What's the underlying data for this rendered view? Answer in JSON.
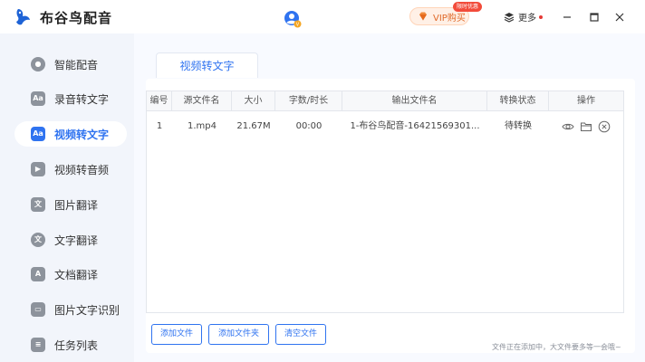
{
  "app": {
    "title": "布谷鸟配音"
  },
  "header": {
    "vip_label": "VIP购买",
    "vip_badge": "限时优惠",
    "more_label": "更多",
    "icons": [
      "bird-logo-icon",
      "user-avatar-icon",
      "diamond-icon",
      "layers-icon",
      "minimize-icon",
      "maximize-icon",
      "close-icon"
    ],
    "accent_color": "#2f73f0",
    "vip_color": "#e06a2a"
  },
  "sidebar": {
    "items": [
      {
        "label": "智能配音",
        "icon": "smart-dubbing-icon",
        "active": false
      },
      {
        "label": "录音转文字",
        "icon": "audio-to-text-icon",
        "active": false
      },
      {
        "label": "视频转文字",
        "icon": "video-to-text-icon",
        "active": true
      },
      {
        "label": "视频转音频",
        "icon": "video-to-audio-icon",
        "active": false
      },
      {
        "label": "图片翻译",
        "icon": "image-translate-icon",
        "active": false
      },
      {
        "label": "文字翻译",
        "icon": "text-translate-icon",
        "active": false
      },
      {
        "label": "文档翻译",
        "icon": "document-translate-icon",
        "active": false
      },
      {
        "label": "图片文字识别",
        "icon": "image-ocr-icon",
        "active": false
      },
      {
        "label": "任务列表",
        "icon": "task-list-icon",
        "active": false
      }
    ]
  },
  "main": {
    "tab_label": "视频转文字",
    "table": {
      "columns": [
        "编号",
        "源文件名",
        "大小",
        "字数/时长",
        "输出文件名",
        "转换状态",
        "操作"
      ],
      "rows": [
        {
          "no": "1",
          "source": "1.mp4",
          "size": "21.67M",
          "duration": "00:00",
          "output": "1-布谷鸟配音-16421569301...",
          "status": "待转换"
        }
      ],
      "row_actions": [
        "eye-icon",
        "folder-icon",
        "delete-circle-icon"
      ]
    },
    "buttons": {
      "add_file": "添加文件",
      "add_folder": "添加文件夹",
      "clear_files": "清空文件"
    },
    "status_text": "文件正在添加中，大文件要多等一会哦~"
  }
}
